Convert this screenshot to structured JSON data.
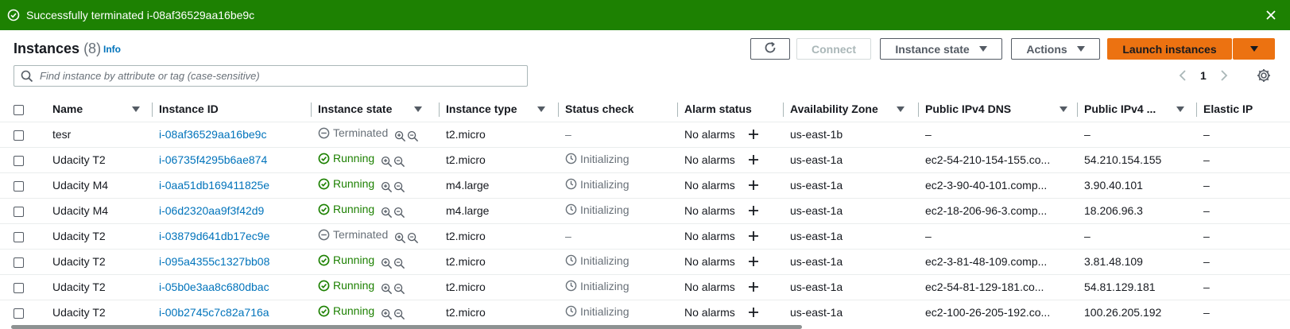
{
  "flash": {
    "message": "Successfully terminated i-08af36529aa16be9c"
  },
  "header": {
    "title": "Instances",
    "count": "(8)",
    "info": "Info"
  },
  "toolbar": {
    "connect": "Connect",
    "instance_state": "Instance state",
    "actions": "Actions",
    "launch": "Launch instances"
  },
  "search": {
    "placeholder": "Find instance by attribute or tag (case-sensitive)"
  },
  "pager": {
    "page": "1"
  },
  "columns": [
    "Name",
    "Instance ID",
    "Instance state",
    "Instance type",
    "Status check",
    "Alarm status",
    "Availability Zone",
    "Public IPv4 DNS",
    "Public IPv4 ...",
    "Elastic IP"
  ],
  "rows": [
    {
      "name": "tesr",
      "id": "i-08af36529aa16be9c",
      "state": "Terminated",
      "type": "t2.micro",
      "status": "–",
      "alarm": "No alarms",
      "az": "us-east-1b",
      "dns": "–",
      "ip": "–",
      "eip": "–"
    },
    {
      "name": "Udacity T2",
      "id": "i-06735f4295b6ae874",
      "state": "Running",
      "type": "t2.micro",
      "status": "Initializing",
      "alarm": "No alarms",
      "az": "us-east-1a",
      "dns": "ec2-54-210-154-155.co...",
      "ip": "54.210.154.155",
      "eip": "–"
    },
    {
      "name": "Udacity M4",
      "id": "i-0aa51db169411825e",
      "state": "Running",
      "type": "m4.large",
      "status": "Initializing",
      "alarm": "No alarms",
      "az": "us-east-1a",
      "dns": "ec2-3-90-40-101.comp...",
      "ip": "3.90.40.101",
      "eip": "–"
    },
    {
      "name": "Udacity M4",
      "id": "i-06d2320aa9f3f42d9",
      "state": "Running",
      "type": "m4.large",
      "status": "Initializing",
      "alarm": "No alarms",
      "az": "us-east-1a",
      "dns": "ec2-18-206-96-3.comp...",
      "ip": "18.206.96.3",
      "eip": "–"
    },
    {
      "name": "Udacity T2",
      "id": "i-03879d641db17ec9e",
      "state": "Terminated",
      "type": "t2.micro",
      "status": "–",
      "alarm": "No alarms",
      "az": "us-east-1a",
      "dns": "–",
      "ip": "–",
      "eip": "–"
    },
    {
      "name": "Udacity T2",
      "id": "i-095a4355c1327bb08",
      "state": "Running",
      "type": "t2.micro",
      "status": "Initializing",
      "alarm": "No alarms",
      "az": "us-east-1a",
      "dns": "ec2-3-81-48-109.comp...",
      "ip": "3.81.48.109",
      "eip": "–"
    },
    {
      "name": "Udacity T2",
      "id": "i-05b0e3aa8c680dbac",
      "state": "Running",
      "type": "t2.micro",
      "status": "Initializing",
      "alarm": "No alarms",
      "az": "us-east-1a",
      "dns": "ec2-54-81-129-181.co...",
      "ip": "54.81.129.181",
      "eip": "–"
    },
    {
      "name": "Udacity T2",
      "id": "i-00b2745c7c82a716a",
      "state": "Running",
      "type": "t2.micro",
      "status": "Initializing",
      "alarm": "No alarms",
      "az": "us-east-1a",
      "dns": "ec2-100-26-205-192.co...",
      "ip": "100.26.205.192",
      "eip": "–"
    }
  ],
  "colors": {
    "success": "#1d8102",
    "link": "#0073bb",
    "primary": "#ec7211"
  }
}
